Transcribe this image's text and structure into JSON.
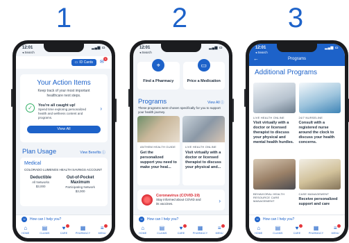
{
  "steps": [
    "1",
    "2",
    "3"
  ],
  "colors": {
    "brand_blue": "#1d62c9",
    "alert_red": "#e5373c",
    "success_green": "#2fae63"
  },
  "phone1": {
    "time": "12:01",
    "back": "◂ Search",
    "id_cards_label": "ID Cards",
    "notification_count": "1",
    "action_title": "Your Action Items",
    "action_subtitle": "Keep track of your most important healthcare next steps.",
    "caught_up_title": "You're all caught up!",
    "caught_up_desc": "Spend time exploring personalized health and wellness content and programs.",
    "view_all": "View All",
    "plan_title": "Plan Usage",
    "plan_link": "View Benefits",
    "medical_title": "Medical",
    "medical_account": "COLORADO LUMENOS HEALTH SAVINGS ACCOUNT",
    "deductible_title": "Deductible",
    "deductible_network": "All Networks",
    "deductible_value": "$3,000",
    "oop_title": "Out-of-Pocket Maximum",
    "oop_network": "Participating Network",
    "oop_value": "$3,000",
    "help": "How can I help you?"
  },
  "tabs": [
    {
      "label": "HOME",
      "icon": "⌂",
      "badge": false
    },
    {
      "label": "CLAIMS",
      "icon": "▤",
      "badge": false
    },
    {
      "label": "CARE",
      "icon": "♥",
      "badge": true
    },
    {
      "label": "PHARMACY",
      "icon": "▦",
      "badge": false
    },
    {
      "label": "MENU",
      "icon": "≡",
      "badge": true
    }
  ],
  "phone2": {
    "time": "12:01",
    "back": "◂ Search",
    "tile1_label": "Find a Pharmacy",
    "tile2_label": "Price a Medication",
    "programs_title": "Programs",
    "programs_link": "View All",
    "programs_sub": "These programs were chosen specifically for you to support your health journey.",
    "card1_type": "ANTHEM HEALTH GUIDE",
    "card1_desc": "Get the personalized support you need to make your heal...",
    "card2_type": "LIVE HEALTH ONLINE",
    "card2_desc": "Visit virtually with a doctor or licensed therapist to discuss your physical and...",
    "covid_title": "Coronavirus (COVID-19)",
    "covid_desc": "Stay informed about COVID and its vaccines.",
    "help": "How can I help you?"
  },
  "phone3": {
    "time": "12:01",
    "back": "◂ Search",
    "nav_title": "Programs",
    "page_title": "Additional Programs",
    "programs": [
      {
        "type": "LIVE HEALTH ONLINE",
        "desc": "Visit virtually with a doctor or licensed therapist to discuss your physical and mental health hurdles."
      },
      {
        "type": "24/7 NURSELINE",
        "desc": "Consult with a registered nurse around the clock to discuss your health concerns."
      },
      {
        "type": "BEHAVIORAL HEALTH RESOURCE CARE MANAGEMENT",
        "desc": ""
      },
      {
        "type": "CASE MANAGEMENT",
        "desc": "Receive personalized support and care"
      }
    ],
    "help": "How can I help you?"
  }
}
